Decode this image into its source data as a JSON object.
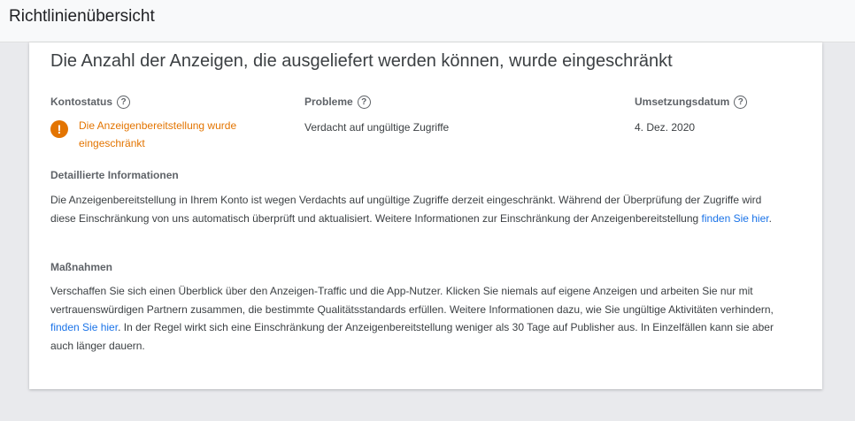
{
  "header": {
    "title": "Richtlinienübersicht"
  },
  "card": {
    "title": "Die Anzahl der Anzeigen, die ausgeliefert werden können, wurde eingeschränkt",
    "columns": [
      {
        "label": "Kontostatus",
        "help_icon": "help-circle-icon",
        "value_line1": "Die Anzeigenbereitstellung wurde",
        "value_line2": "eingeschränkt",
        "status_color": "#e37400",
        "status_icon": "warning-icon"
      },
      {
        "label": "Probleme",
        "help_icon": "help-circle-icon",
        "value": "Verdacht auf ungültige Zugriffe"
      },
      {
        "label": "Umsetzungsdatum",
        "help_icon": "help-circle-icon",
        "value": "4. Dez. 2020"
      }
    ],
    "details": {
      "heading": "Detaillierte Informationen",
      "text_before_link": "Die Anzeigenbereitstellung in Ihrem Konto ist wegen Verdachts auf ungültige Zugriffe derzeit eingeschränkt. Während der Überprüfung der Zugriffe wird diese Einschränkung von uns automatisch überprüft und aktualisiert. Weitere Informationen zur Einschränkung der Anzeigenbereitstellung ",
      "link_text": "finden Sie hier",
      "text_after_link": "."
    },
    "actions": {
      "heading": "Maßnahmen",
      "text_before_link": "Verschaffen Sie sich einen Überblick über den Anzeigen-Traffic und die App-Nutzer. Klicken Sie niemals auf eigene Anzeigen und arbeiten Sie nur mit vertrauenswürdigen Partnern zusammen, die bestimmte Qualitätsstandards erfüllen. Weitere Informationen dazu, wie Sie ungültige Aktivitäten verhindern, ",
      "link_text": "finden Sie hier",
      "text_after_link": ". In der Regel wirkt sich eine Einschränkung der Anzeigenbereitstellung weniger als 30 Tage auf Publisher aus. In Einzelfällen kann sie aber auch länger dauern."
    }
  },
  "colors": {
    "link": "#1a73e8",
    "warning": "#e37400",
    "background": "#e9eaed"
  }
}
